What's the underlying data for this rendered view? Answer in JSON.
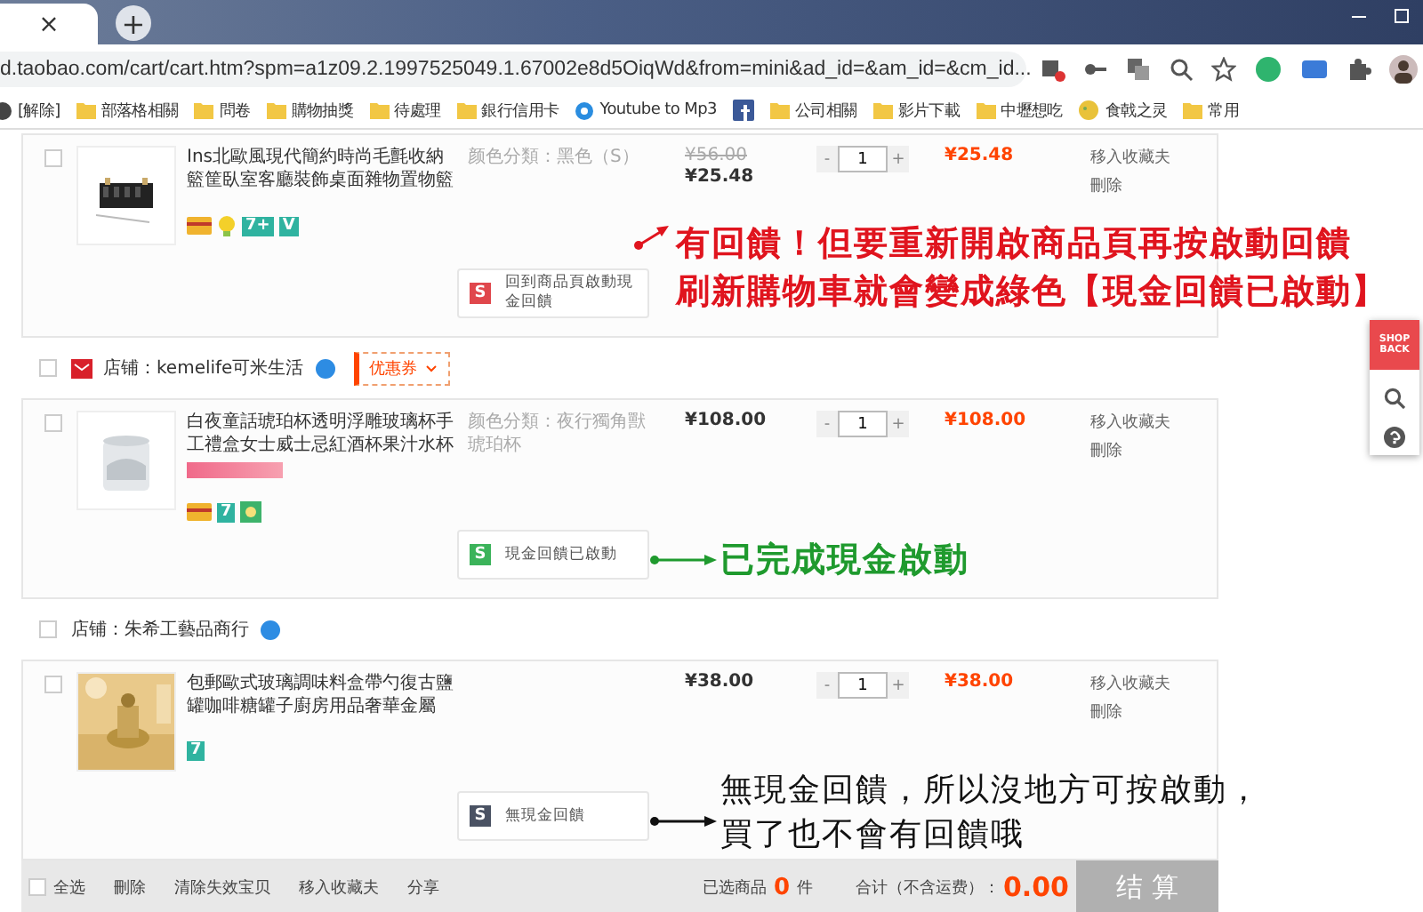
{
  "browser": {
    "tab_close": "×",
    "new_tab": "+",
    "url": "d.taobao.com/cart/cart.htm?spm=a1z09.2.1997525049.1.67002e8d5OiqWd&from=mini&ad_id=&am_id=&cm_id...",
    "bookmarks": [
      {
        "kind": "plain",
        "label": "[解除]"
      },
      {
        "kind": "folder",
        "label": "部落格相關"
      },
      {
        "kind": "folder",
        "label": "問卷"
      },
      {
        "kind": "folder",
        "label": "購物抽獎"
      },
      {
        "kind": "folder",
        "label": "待處理"
      },
      {
        "kind": "folder",
        "label": "銀行信用卡"
      },
      {
        "kind": "site",
        "label": "Youtube to Mp3"
      },
      {
        "kind": "facebook"
      },
      {
        "kind": "folder",
        "label": "公司相關"
      },
      {
        "kind": "folder",
        "label": "影片下載"
      },
      {
        "kind": "folder",
        "label": "中壢想吃"
      },
      {
        "kind": "emoji",
        "label": "食戟之灵"
      },
      {
        "kind": "folder",
        "label": "常用"
      }
    ]
  },
  "sections": [
    {
      "items": [
        {
          "title": "Ins北歐風現代簡約時尚毛氈收納籃筐臥室客廳裝飾桌面雜物置物籃",
          "spec": "颜色分類：黑色（S）",
          "original_price": "¥56.00",
          "price": "¥25.48",
          "quantity": "1",
          "minus": "-",
          "plus": "+",
          "total": "¥25.48",
          "actions": [
            "移入收藏夫",
            "刪除"
          ],
          "promo": false,
          "checked": false,
          "services": [
            {
              "kind": "card"
            },
            {
              "kind": "bulb"
            },
            {
              "kind": "tag",
              "text": "7+"
            },
            {
              "kind": "tag",
              "text": "V"
            }
          ],
          "cashback": {
            "color": "#e0474c",
            "icon": "S",
            "label": "回到商品頁啟動現金回饋"
          }
        }
      ]
    },
    {
      "shop": {
        "name": "店铺：kemelife可米生活",
        "logo": true,
        "checked": false,
        "coupon": "优惠券"
      },
      "items": [
        {
          "title": "白夜童話琥珀杯透明浮雕玻璃杯手工禮盒女士威士忌紅酒杯果汁水杯",
          "spec": "颜色分類：夜行獨角獸琥珀杯",
          "price": "¥108.00",
          "quantity": "1",
          "minus": "-",
          "plus": "+",
          "total": "¥108.00",
          "actions": [
            "移入收藏夫",
            "刪除"
          ],
          "promo": true,
          "checked": false,
          "services": [
            {
              "kind": "card"
            },
            {
              "kind": "tag",
              "text": "7"
            },
            {
              "kind": "flower"
            }
          ],
          "cashback": {
            "color": "#3bb35a",
            "icon": "S",
            "label": "現金回饋已啟動"
          }
        }
      ]
    },
    {
      "shop": {
        "name": "店铺：朱希工藝品商行",
        "logo": false,
        "checked": false
      },
      "items": [
        {
          "title": "包郵歐式玻璃調味料盒帶勺復古鹽罐咖啡糖罐子廚房用品奢華金屬",
          "price": "¥38.00",
          "quantity": "1",
          "minus": "-",
          "plus": "+",
          "total": "¥38.00",
          "actions": [
            "移入收藏夫",
            "刪除"
          ],
          "promo": false,
          "checked": false,
          "services": [
            {
              "kind": "tag",
              "text": "7"
            }
          ],
          "cashback": {
            "color": "#4a5263",
            "icon": "S",
            "label": "無現金回饋"
          }
        }
      ]
    }
  ],
  "footer": {
    "select_all": "全选",
    "checked": false,
    "actions": [
      "刪除",
      "清除失效宝贝",
      "移入收藏夫",
      "分享"
    ],
    "selected_label": "已选商品",
    "selected_count": "0",
    "unit": "件",
    "total_label": "合计（不含运费）：",
    "total": "0.00",
    "checkout": "结 算"
  },
  "annotations": [
    {
      "color": "#e0141e",
      "lines": [
        "有回饋！但要重新開啟商品頁再按啟動回饋",
        "刷新購物車就會變成綠色【現金回饋已啟動】"
      ]
    },
    {
      "color": "#1f9a2e",
      "lines": [
        "已完成現金啟動"
      ]
    },
    {
      "color": "#111111",
      "lines": [
        "無現金回饋，所以沒地方可按啟動，",
        "買了也不會有回饋哦"
      ]
    }
  ],
  "sidebar": {
    "logo_lines": [
      "SHOP",
      "BACK"
    ]
  }
}
